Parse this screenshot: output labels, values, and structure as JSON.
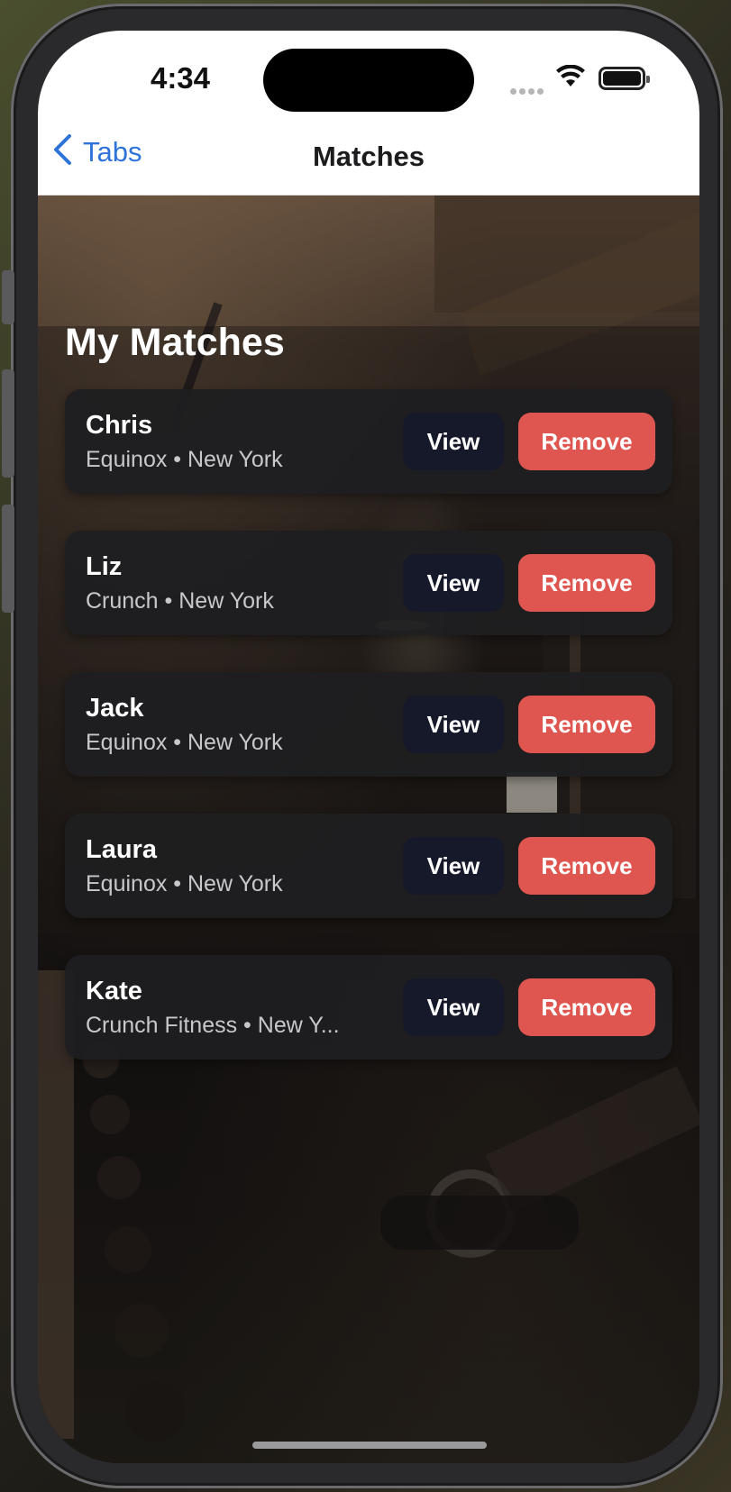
{
  "status_bar": {
    "time": "4:34"
  },
  "nav": {
    "back_label": "Tabs",
    "title": "Matches"
  },
  "page": {
    "heading": "My Matches"
  },
  "matches": [
    {
      "name": "Chris",
      "subtitle": "Equinox • New York",
      "view_label": "View",
      "remove_label": "Remove"
    },
    {
      "name": "Liz",
      "subtitle": "Crunch • New York",
      "view_label": "View",
      "remove_label": "Remove"
    },
    {
      "name": "Jack",
      "subtitle": "Equinox • New York",
      "view_label": "View",
      "remove_label": "Remove"
    },
    {
      "name": "Laura",
      "subtitle": "Equinox • New York",
      "view_label": "View",
      "remove_label": "Remove"
    },
    {
      "name": "Kate",
      "subtitle": "Crunch Fitness • New Y...",
      "view_label": "View",
      "remove_label": "Remove"
    }
  ],
  "icons": {
    "back": "chevron-left-icon",
    "signal": "cellular-signal-icon",
    "wifi": "wifi-icon",
    "battery": "battery-icon"
  },
  "colors": {
    "accent": "#2f73d9",
    "remove_button": "#df5650",
    "view_button": "#16192a",
    "card_background": "#1e1e20"
  }
}
